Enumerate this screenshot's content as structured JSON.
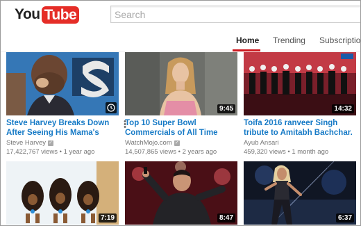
{
  "header": {
    "logo_you": "You",
    "logo_tube": "Tube",
    "search_placeholder": "Search"
  },
  "tabs": [
    {
      "label": "Home",
      "active": true
    },
    {
      "label": "Trending",
      "active": false
    },
    {
      "label": "Subscription",
      "active": false
    }
  ],
  "videos": [
    {
      "title": "Steve Harvey Breaks Down After Seeing His Mama's",
      "channel": "Steve Harvey",
      "verified": true,
      "views": "17,422,767 views",
      "age": "1 year ago",
      "duration": ""
    },
    {
      "title": "Top 10 Super Bowl Commercials of All Time",
      "channel": "WatchMojo.com",
      "verified": true,
      "views": "14,507,865 views",
      "age": "2 years ago",
      "duration": "9:45"
    },
    {
      "title": "Toifa 2016 ranveer Singh tribute to Amitabh Bachchar.",
      "channel": "Ayub Ansari",
      "verified": false,
      "views": "459,320 views",
      "age": "1 month ago",
      "duration": "14:32"
    },
    {
      "title": "",
      "channel": "",
      "verified": false,
      "views": "",
      "age": "",
      "duration": "7:19"
    },
    {
      "title": "",
      "channel": "",
      "verified": false,
      "views": "",
      "age": "",
      "duration": "8:47"
    },
    {
      "title": "",
      "channel": "",
      "verified": false,
      "views": "",
      "age": "",
      "duration": "6:37"
    }
  ],
  "colors": {
    "brand_red": "#e52d27",
    "link_blue": "#167ac6",
    "tab_underline": "#cc181e",
    "meta_gray": "#767676"
  },
  "icons": {
    "watch_later": "clock-icon",
    "more": "more-vert-icon",
    "verified": "verified-check-icon"
  }
}
